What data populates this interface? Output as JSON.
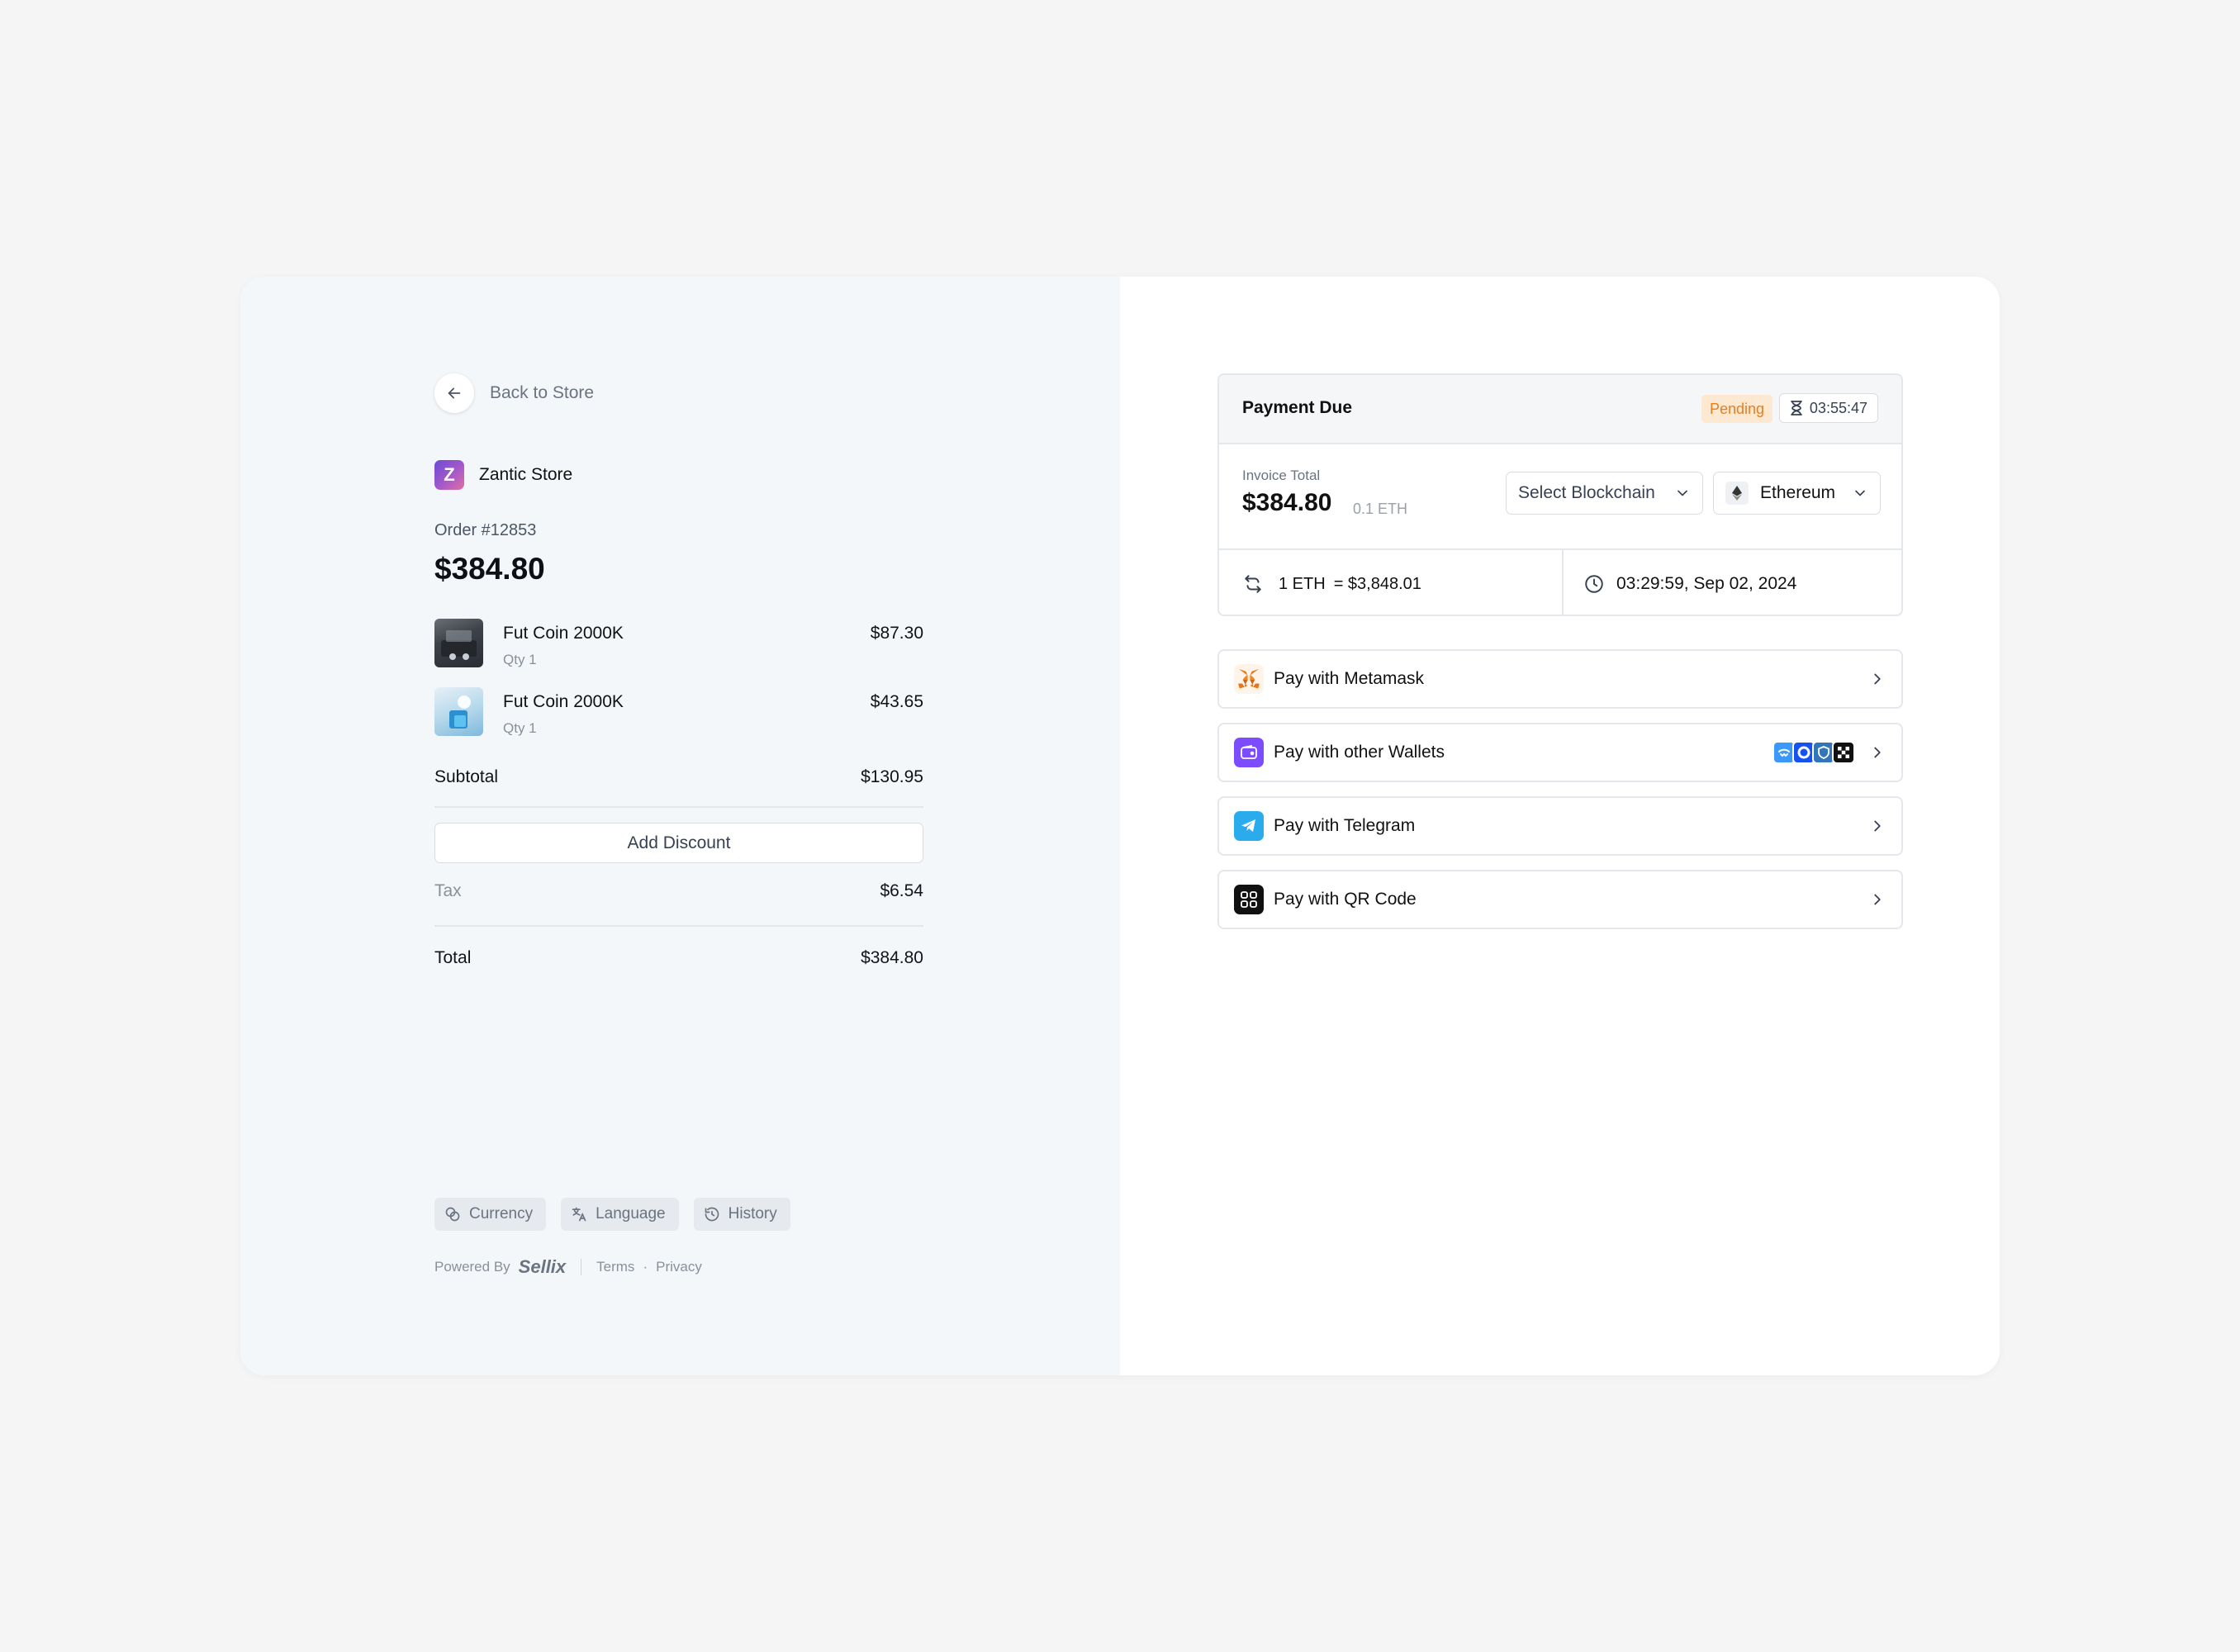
{
  "nav": {
    "back_label": "Back to Store"
  },
  "store": {
    "name": "Zantic Store",
    "logo_letter": "Z"
  },
  "order": {
    "number": "Order #12853",
    "total": "$384.80",
    "items": [
      {
        "name": "Fut Coin 2000K",
        "qty": "Qty 1",
        "price": "$87.30"
      },
      {
        "name": "Fut Coin 2000K",
        "qty": "Qty 1",
        "price": "$43.65"
      }
    ],
    "subtotal_label": "Subtotal",
    "subtotal": "$130.95",
    "discount_label": "Add Discount",
    "tax_label": "Tax",
    "tax": "$6.54",
    "total_label": "Total",
    "grand_total": "$384.80"
  },
  "chips": {
    "currency": "Currency",
    "language": "Language",
    "history": "History"
  },
  "footer": {
    "powered_by": "Powered By",
    "brand": "Sellix",
    "terms": "Terms",
    "separator": "·",
    "privacy": "Privacy"
  },
  "payment": {
    "title": "Payment Due",
    "status": "Pending",
    "timer": "03:55:47",
    "invoice_label": "Invoice Total",
    "invoice_total": "$384.80",
    "invoice_eth": "0.1 ETH",
    "blockchain_placeholder": "Select Blockchain",
    "selected_chain": "Ethereum",
    "rate_left": "1 ETH",
    "rate_right": "= $3,848.01",
    "datetime": "03:29:59, Sep 02, 2024"
  },
  "methods": {
    "metamask": "Pay with Metamask",
    "wallets": "Pay with other Wallets",
    "telegram": "Pay with Telegram",
    "qr": "Pay with QR Code"
  },
  "colors": {
    "pending_bg": "#fde8d2",
    "pending_text": "#e67e22",
    "wallet_purple": "#7c4dff",
    "telegram_blue": "#2aabee",
    "qr_black": "#111111"
  }
}
